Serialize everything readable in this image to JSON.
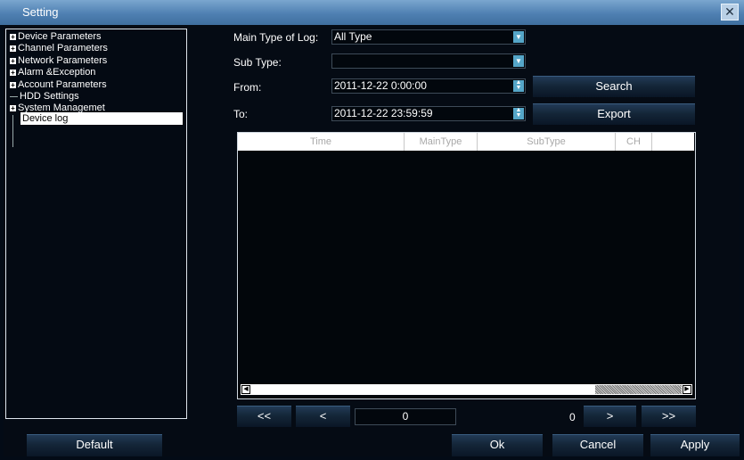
{
  "window": {
    "title": "Setting",
    "close_symbol": "✕"
  },
  "tree": {
    "items": [
      {
        "label": "Device Parameters",
        "expandable": true
      },
      {
        "label": "Channel Parameters",
        "expandable": true
      },
      {
        "label": "Network Parameters",
        "expandable": true
      },
      {
        "label": "Alarm &Exception",
        "expandable": true
      },
      {
        "label": "Account Parameters",
        "expandable": true
      },
      {
        "label": "HDD Settings",
        "expandable": false
      },
      {
        "label": "System Managemet",
        "expandable": true
      },
      {
        "label": "Device log",
        "expandable": false,
        "selected": true
      }
    ]
  },
  "filters": {
    "main_type_label": "Main Type of Log:",
    "main_type_value": "All Type",
    "sub_type_label": "Sub Type:",
    "sub_type_value": "",
    "from_label": "From:",
    "from_value": "2011-12-22 0:00:00",
    "to_label": "To:",
    "to_value": "2011-12-22 23:59:59"
  },
  "actions": {
    "search_label": "Search",
    "export_label": "Export"
  },
  "log_table": {
    "columns": [
      "Time",
      "MainType",
      "SubType",
      "CH"
    ],
    "rows": []
  },
  "pager": {
    "first_label": "<<",
    "prev_label": "<",
    "next_label": ">",
    "last_label": ">>",
    "current_page": "0",
    "total_pages": "0"
  },
  "footer": {
    "default_label": "Default",
    "ok_label": "Ok",
    "cancel_label": "Cancel",
    "apply_label": "Apply"
  },
  "colors": {
    "title_bar": "#4f80b2",
    "background": "#050b14",
    "dropdown_accent": "#55a6c8",
    "button": "#142638"
  }
}
